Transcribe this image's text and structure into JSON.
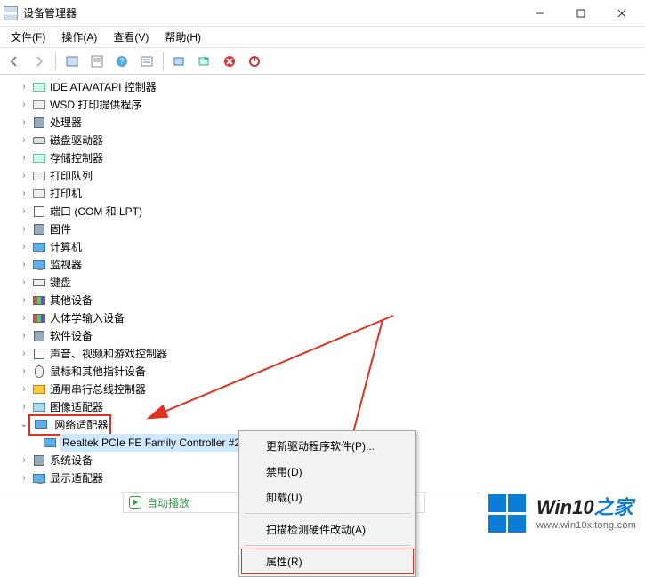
{
  "window": {
    "title": "设备管理器"
  },
  "menubar": [
    {
      "label": "文件(F)"
    },
    {
      "label": "操作(A)"
    },
    {
      "label": "查看(V)"
    },
    {
      "label": "帮助(H)"
    }
  ],
  "tree": {
    "items": [
      {
        "label": "IDE ATA/ATAPI 控制器",
        "icon": "controller"
      },
      {
        "label": "WSD 打印提供程序",
        "icon": "print"
      },
      {
        "label": "处理器",
        "icon": "chip"
      },
      {
        "label": "磁盘驱动器",
        "icon": "disk"
      },
      {
        "label": "存储控制器",
        "icon": "controller"
      },
      {
        "label": "打印队列",
        "icon": "print"
      },
      {
        "label": "打印机",
        "icon": "print"
      },
      {
        "label": "端口 (COM 和 LPT)",
        "icon": "port"
      },
      {
        "label": "固件",
        "icon": "chip"
      },
      {
        "label": "计算机",
        "icon": "monitor"
      },
      {
        "label": "监视器",
        "icon": "monitor"
      },
      {
        "label": "键盘",
        "icon": "keyboard"
      },
      {
        "label": "其他设备",
        "icon": "hid"
      },
      {
        "label": "人体学输入设备",
        "icon": "hid"
      },
      {
        "label": "软件设备",
        "icon": "chip"
      },
      {
        "label": "声音、视频和游戏控制器",
        "icon": "port"
      },
      {
        "label": "鼠标和其他指针设备",
        "icon": "mouse"
      },
      {
        "label": "通用串行总线控制器",
        "icon": "usb"
      },
      {
        "label": "图像适配器",
        "icon": "image"
      }
    ],
    "network_adapter_label": "网络适配器",
    "network_child": "Realtek PCIe FE Family Controller #2",
    "after_network": [
      {
        "label": "系统设备",
        "icon": "chip"
      },
      {
        "label": "显示适配器",
        "icon": "monitor"
      }
    ]
  },
  "context_menu": {
    "items": [
      "更新驱动程序软件(P)...",
      "禁用(D)",
      "卸载(U)",
      "扫描检测硬件改动(A)",
      "属性(R)"
    ]
  },
  "autoplay": {
    "label": "自动播放"
  },
  "watermark": {
    "title_a": "Win10",
    "title_b": "之家",
    "url": "www.win10xitong.com"
  }
}
